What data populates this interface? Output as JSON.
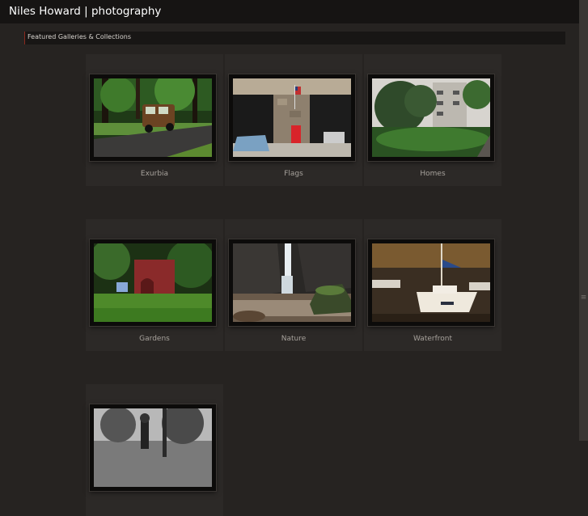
{
  "header": {
    "title": "Niles Howard | photography"
  },
  "breadcrumb": {
    "label": "Featured Galleries & Collections"
  },
  "scrollbar": {
    "grip_glyph": "≡"
  },
  "galleries": [
    {
      "name": "Exurbia",
      "icon": "vintage-car-photo"
    },
    {
      "name": "Flags",
      "icon": "garage-flag-photo"
    },
    {
      "name": "Homes",
      "icon": "building-hedge-photo"
    },
    {
      "name": "Gardens",
      "icon": "red-barn-photo"
    },
    {
      "name": "Nature",
      "icon": "waterfall-photo"
    },
    {
      "name": "Waterfront",
      "icon": "sailboat-photo"
    },
    {
      "name": "",
      "icon": "bw-forest-photo"
    }
  ]
}
